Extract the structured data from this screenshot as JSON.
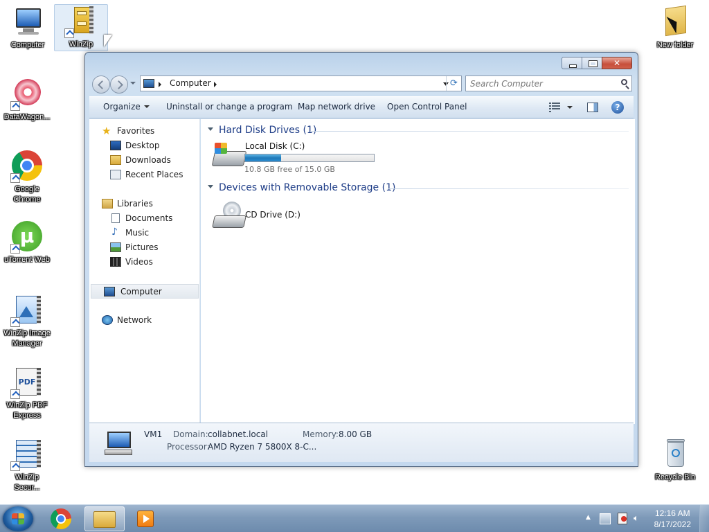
{
  "desktop": {
    "icons": {
      "computer": "Computer",
      "winzip": "WinZip",
      "datawagon": "DataWagon...",
      "chrome_l1": "Google",
      "chrome_l2": "Chrome",
      "utorrent": "uTorrent Web",
      "wz_image_l1": "WinZip Image",
      "wz_image_l2": "Manager",
      "wz_pdf_l1": "WinZip PDF",
      "wz_pdf_l2": "Express",
      "wz_secure_l1": "WinZip",
      "wz_secure_l2": "Secur...",
      "new_folder": "New folder",
      "recycle_bin": "Recycle Bin"
    }
  },
  "window": {
    "address": {
      "location": "Computer"
    },
    "search": {
      "placeholder": "Search Computer"
    },
    "toolbar": {
      "organize": "Organize",
      "uninstall": "Uninstall or change a program",
      "map_drive": "Map network drive",
      "control_panel": "Open Control Panel"
    },
    "nav": {
      "favorites": "Favorites",
      "desktop": "Desktop",
      "downloads": "Downloads",
      "recent": "Recent Places",
      "libraries": "Libraries",
      "documents": "Documents",
      "music": "Music",
      "pictures": "Pictures",
      "videos": "Videos",
      "computer": "Computer",
      "network": "Network"
    },
    "groups": {
      "hdd": "Hard Disk Drives (1)",
      "removable": "Devices with Removable Storage (1)"
    },
    "drives": {
      "c_name": "Local Disk (C:)",
      "c_free": "10.8 GB free of 15.0 GB",
      "c_used_fraction": 0.28,
      "d_name": "CD Drive (D:)"
    },
    "details": {
      "name": "VM1",
      "domain_label": "Domain:",
      "domain_value": "collabnet.local",
      "memory_label": "Memory:",
      "memory_value": "8.00 GB",
      "processor_label": "Processor:",
      "processor_value": "AMD Ryzen 7 5800X 8-C..."
    }
  },
  "taskbar": {
    "time": "12:16 AM",
    "date": "8/17/2022"
  }
}
